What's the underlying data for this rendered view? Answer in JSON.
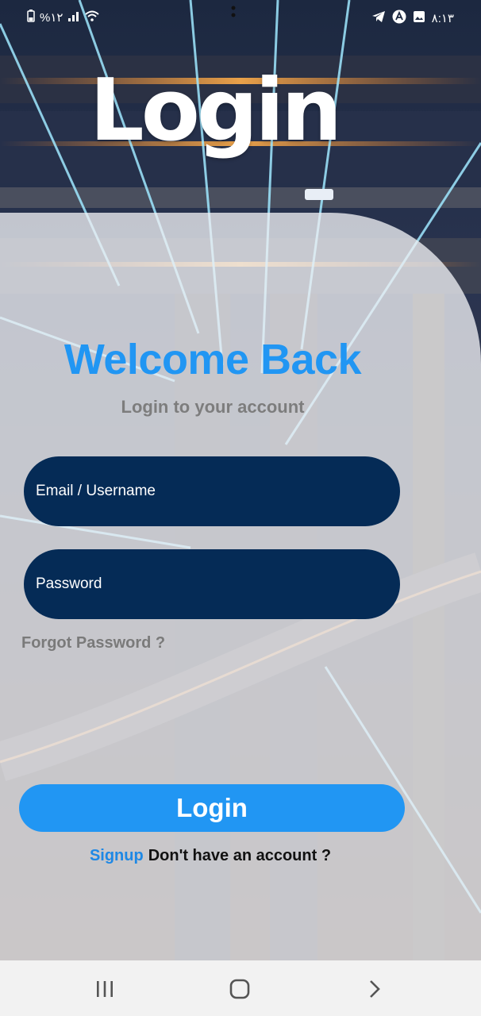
{
  "status_bar": {
    "battery_text": "%۱۲",
    "time": "۸:۱۳"
  },
  "header": {
    "title": "Login"
  },
  "card": {
    "welcome_title": "Welcome Back",
    "subtitle": "Login to your account"
  },
  "form": {
    "email_placeholder": "Email / Username",
    "email_value": "",
    "password_placeholder": "Password",
    "password_value": "",
    "forgot_label": "Forgot Password ?",
    "login_label": "Login",
    "signup_label": "Signup",
    "signup_question": "Don't have an account ?"
  },
  "nav_bar": {
    "icons": [
      "recent-apps-icon",
      "home-icon",
      "back-icon"
    ]
  },
  "colors": {
    "accent": "#2196f3",
    "field_bg": "#052b56",
    "subtitle": "#7d7d7d"
  }
}
